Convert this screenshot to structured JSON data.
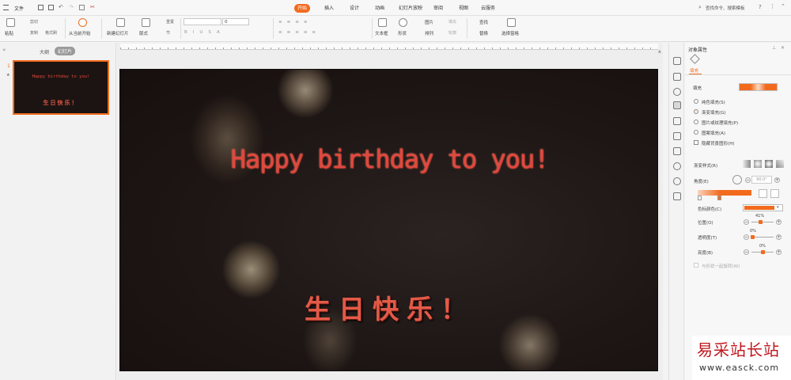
{
  "menubar": {
    "file_label": "文件",
    "tabs": [
      "开始",
      "插入",
      "设计",
      "动画",
      "幻灯片放映",
      "审阅",
      "视图",
      "云服务"
    ],
    "active_tab": "开始",
    "search_placeholder": "查找命令、搜索模板"
  },
  "ribbon": {
    "paste": "粘贴",
    "cut": "剪切",
    "copy": "复制",
    "format_painter": "格式刷",
    "from_current": "从当前开始",
    "new_slide": "新建幻灯片",
    "layout": "版式",
    "reset": "重置",
    "section": "节",
    "font_size": "0",
    "textbox": "文本框",
    "shape": "形状",
    "picture": "图片",
    "fill": "填充",
    "arrange": "排列",
    "outline": "轮廓",
    "find": "查找",
    "replace": "替换",
    "select_pane": "选择窗格"
  },
  "leftpanel": {
    "tab_outline": "大纲",
    "tab_slides": "幻灯片",
    "slide_number": "1",
    "star": "★"
  },
  "slide": {
    "title": "Happy birthday to you!",
    "subtitle": "生日快乐！"
  },
  "rightpanel": {
    "header": "对象属性",
    "tab_fill": "填充",
    "section_fill": "填充",
    "options": [
      "纯色填充(S)",
      "渐变填充(G)",
      "图片或纹理填充(P)",
      "图案填充(A)"
    ],
    "selected_option": "渐变填充(G)",
    "hide_bg": "隐藏背景图形(H)",
    "gradient_style": "渐变样式(R)",
    "angle_label": "角度(E)",
    "angle_value": "90.0°",
    "stop_color": "色标颜色(C)",
    "position_label": "位置(O)",
    "position_value": "41%",
    "transparency_label": "透明度(T)",
    "transparency_value": "0%",
    "brightness_label": "亮度(B)",
    "brightness_value": "0%",
    "rotate_with_shape": "与形状一起旋转(W)"
  },
  "watermark": {
    "cn": "易采站长站",
    "url": "www.easck.com"
  },
  "colors": {
    "accent": "#f26b1d",
    "slide_bg": "#1d1614",
    "title": "#e2473e"
  }
}
